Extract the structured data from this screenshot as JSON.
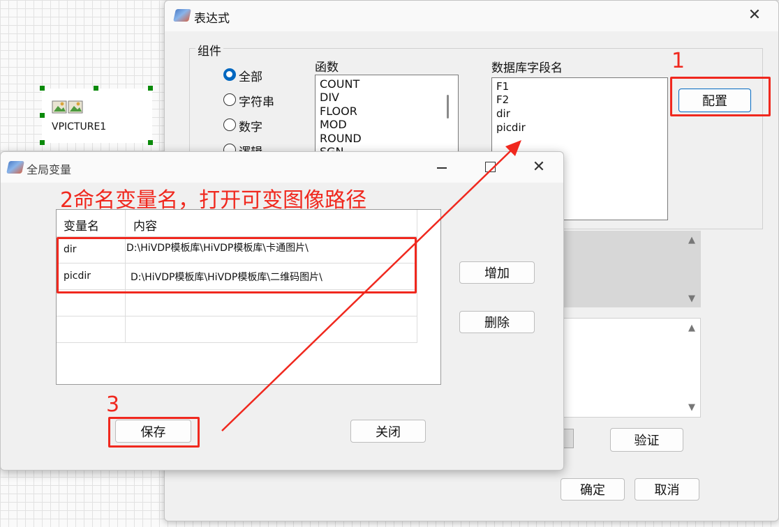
{
  "canvas": {
    "component_name": "VPICTURE1"
  },
  "expr_dialog": {
    "title": "表达式",
    "group_label": "组件",
    "radios": [
      {
        "label": "全部",
        "selected": true
      },
      {
        "label": "字符串",
        "selected": false
      },
      {
        "label": "数字",
        "selected": false
      },
      {
        "label": "逻辑",
        "selected": false
      }
    ],
    "functions_label": "函数",
    "functions": [
      "COUNT",
      "DIV",
      "FLOOR",
      "MOD",
      "ROUND",
      "SGN"
    ],
    "fields_label": "数据库字段名",
    "fields": [
      "F1",
      "F2",
      "dir",
      "picdir"
    ],
    "config_button": "配置",
    "verify_button": "验证",
    "ok_button": "确定",
    "cancel_button": "取消"
  },
  "global_dialog": {
    "title": "全局变量",
    "table_headers": [
      "变量名",
      "内容"
    ],
    "rows": [
      {
        "name": "dir",
        "content": "D:\\HiVDP模板库\\HiVDP模板库\\卡通图片\\"
      },
      {
        "name": "picdir",
        "content": "D:\\HiVDP模板库\\HiVDP模板库\\二维码图片\\"
      }
    ],
    "add_button": "增加",
    "delete_button": "删除",
    "save_button": "保存",
    "close_button": "关闭"
  },
  "annotations": {
    "step1": "1",
    "step2": "2命名变量名，打开可变图像路径",
    "step3": "3",
    "color": "#f0281e"
  }
}
